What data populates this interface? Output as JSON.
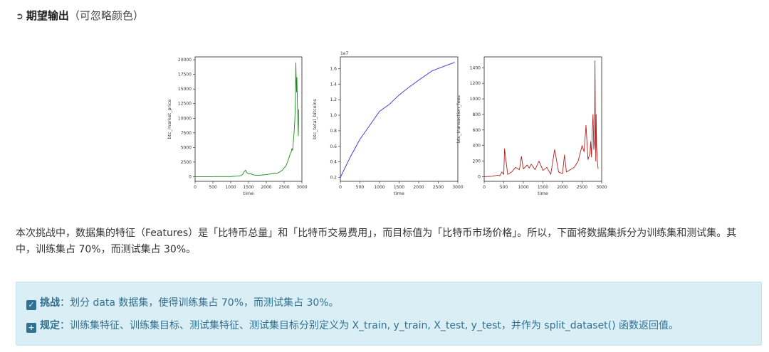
{
  "heading": {
    "icon": "arrow-right-box-icon",
    "bold": "期望输出",
    "note": "（可忽略颜色）"
  },
  "charts": [
    {
      "type": "line",
      "ylabel": "btc_market_price",
      "xlabel": "time",
      "color": "#1a8a1a",
      "xlim": [
        0,
        3000
      ],
      "ylim": [
        -800,
        20500
      ],
      "xticks": [
        "0",
        "500",
        "1000",
        "1500",
        "2000",
        "2500",
        "3000"
      ],
      "yticks": [
        "0",
        "2500",
        "5000",
        "7500",
        "10000",
        "12500",
        "15000",
        "17500",
        "20000"
      ],
      "x": [
        0,
        200,
        400,
        600,
        800,
        1000,
        1200,
        1300,
        1350,
        1380,
        1420,
        1450,
        1500,
        1550,
        1600,
        1700,
        1800,
        1900,
        2000,
        2100,
        2200,
        2300,
        2400,
        2450,
        2500,
        2550,
        2600,
        2650,
        2700,
        2720,
        2740,
        2760,
        2780,
        2800,
        2810,
        2820,
        2830,
        2840,
        2850,
        2860,
        2870,
        2880,
        2890,
        2900,
        2910
      ],
      "y": [
        0,
        5,
        8,
        10,
        12,
        15,
        100,
        200,
        500,
        900,
        1100,
        700,
        500,
        600,
        350,
        250,
        250,
        300,
        350,
        450,
        600,
        550,
        900,
        1100,
        1500,
        1800,
        2600,
        3500,
        4300,
        4800,
        4500,
        6000,
        7500,
        9500,
        11500,
        14000,
        19500,
        16500,
        14500,
        17000,
        13500,
        11000,
        9000,
        7000,
        11500
      ]
    },
    {
      "type": "line",
      "ylabel": "btc_total_bitcoins",
      "xlabel": "time",
      "exponent": "1e7",
      "color": "#3333dd",
      "xlim": [
        0,
        3000
      ],
      "ylim": [
        0.15,
        1.75
      ],
      "xticks": [
        "0",
        "500",
        "1000",
        "1500",
        "2000",
        "2500",
        "3000"
      ],
      "yticks": [
        "0.2",
        "0.4",
        "0.6",
        "0.8",
        "1.0",
        "1.2",
        "1.4",
        "1.6"
      ],
      "x": [
        0,
        250,
        500,
        750,
        1000,
        1250,
        1500,
        1750,
        2000,
        2340,
        2600,
        2920
      ],
      "y": [
        0.2,
        0.46,
        0.69,
        0.87,
        1.05,
        1.14,
        1.26,
        1.36,
        1.45,
        1.57,
        1.62,
        1.68
      ]
    },
    {
      "type": "line",
      "ylabel": "btc_transaction_fees",
      "xlabel": "time",
      "color": "#b22222",
      "xlim": [
        0,
        3000
      ],
      "ylim": [
        -60,
        1540
      ],
      "xticks": [
        "0",
        "500",
        "1000",
        "1500",
        "2000",
        "2500",
        "3000"
      ],
      "yticks": [
        "0",
        "200",
        "400",
        "600",
        "800",
        "1000",
        "1200",
        "1400"
      ],
      "x": [
        0,
        200,
        350,
        400,
        450,
        500,
        520,
        600,
        700,
        800,
        900,
        950,
        1000,
        1100,
        1150,
        1200,
        1300,
        1400,
        1500,
        1600,
        1700,
        1800,
        1900,
        2000,
        2050,
        2100,
        2200,
        2300,
        2400,
        2500,
        2550,
        2600,
        2650,
        2700,
        2720,
        2740,
        2760,
        2780,
        2800,
        2820,
        2830,
        2840,
        2850,
        2860,
        2870,
        2880,
        2890,
        2900,
        2910
      ],
      "y": [
        0,
        5,
        20,
        10,
        60,
        30,
        360,
        30,
        60,
        120,
        90,
        260,
        100,
        150,
        110,
        160,
        90,
        200,
        80,
        120,
        30,
        350,
        60,
        40,
        280,
        60,
        90,
        120,
        200,
        400,
        320,
        660,
        220,
        300,
        450,
        250,
        600,
        800,
        350,
        500,
        1490,
        600,
        200,
        800,
        400,
        300,
        200,
        150,
        100
      ]
    }
  ],
  "paragraph": "本次挑战中，数据集的特征（Features）是「比特币总量」和「比特币交易费用」，而目标值为「比特币市场价格」。所以，下面将数据集拆分为训练集和测试集。其中，训练集占 70%，而测试集占 30%。",
  "callout": {
    "challenge_icon": "check-square-icon",
    "challenge_label": "挑战",
    "challenge_text": "：划分 data 数据集，使得训练集占 70%，而测试集占 30%。",
    "rule_icon": "plus-square-icon",
    "rule_label": "规定",
    "rule_text": "：训练集特征、训练集目标、测试集特征、测试集目标分别定义为 X_train, y_train, X_test, y_test，并作为 split_dataset() 函数返回值。"
  }
}
